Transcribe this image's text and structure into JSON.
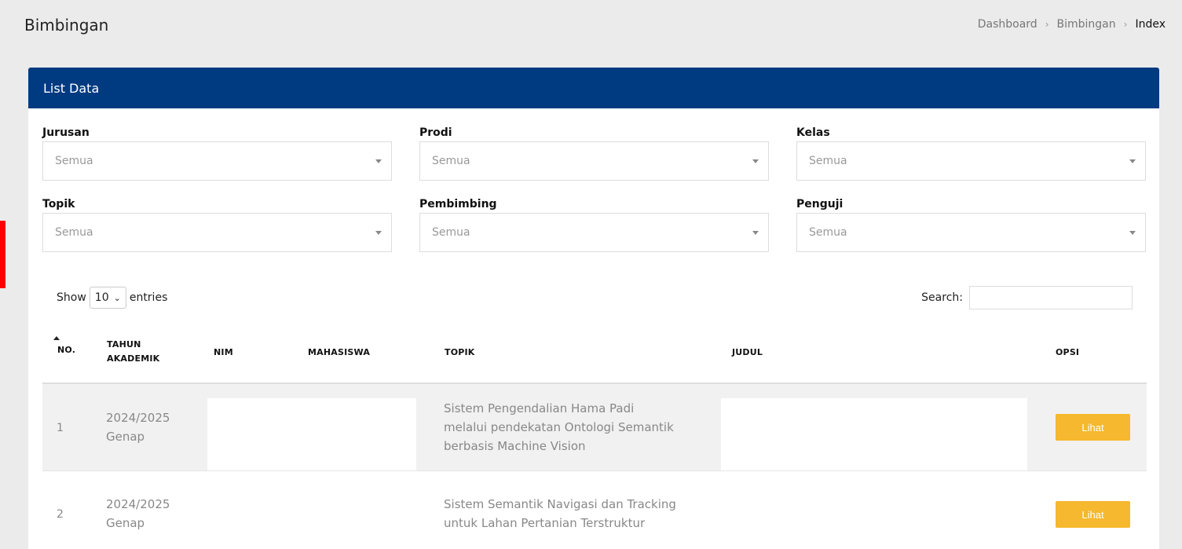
{
  "page": {
    "title": "Bimbingan",
    "breadcrumb": {
      "item1": "Dashboard",
      "item2": "Bimbingan",
      "current": "Index",
      "separator": "›"
    }
  },
  "card": {
    "title": "List Data",
    "header_color": "#003a80"
  },
  "filters": {
    "jurusan": {
      "label": "Jurusan",
      "value": "Semua"
    },
    "prodi": {
      "label": "Prodi",
      "value": "Semua"
    },
    "kelas": {
      "label": "Kelas",
      "value": "Semua"
    },
    "topik": {
      "label": "Topik",
      "value": "Semua"
    },
    "pembimbing": {
      "label": "Pembimbing",
      "value": "Semua"
    },
    "penguji": {
      "label": "Penguji",
      "value": "Semua"
    }
  },
  "table_controls": {
    "show_label": "Show",
    "length_value": "10",
    "entries_label": "entries",
    "search_label": "Search:",
    "search_value": ""
  },
  "table": {
    "columns": {
      "no": "NO.",
      "tahun_1": "TAHUN",
      "tahun_2": "AKADEMIK",
      "nim": "NIM",
      "mahasiswa": "MAHASISWA",
      "topik": "TOPIK",
      "judul": "JUDUL",
      "opsi": "OPSI"
    },
    "rows": [
      {
        "no": "1",
        "tahun_1": "2024/2025",
        "tahun_2": "Genap",
        "topik_1": "Sistem Pengendalian Hama Padi",
        "topik_2": "melalui pendekatan Ontologi Semantik",
        "topik_3": "berbasis Machine Vision",
        "action": "Lihat"
      },
      {
        "no": "2",
        "tahun_1": "2024/2025",
        "tahun_2": "Genap",
        "topik_1": "Sistem Semantik Navigasi dan Tracking",
        "topik_2": "untuk Lahan Pertanian Terstruktur",
        "action": "Lihat"
      }
    ]
  },
  "colors": {
    "accent_button": "#f5b82e",
    "marker": "#ff0000"
  }
}
